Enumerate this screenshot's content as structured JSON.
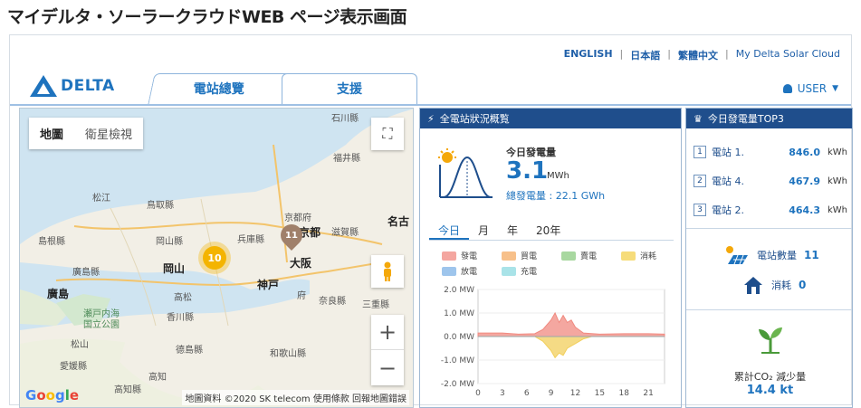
{
  "page_title": "マイデルタ・ソーラークラウドWEB ページ表示画面",
  "languages": [
    "ENGLISH",
    "日本語",
    "繁體中文",
    "My Delta Solar Cloud"
  ],
  "brand": {
    "logo_text": "DELTA",
    "color": "#1e73be"
  },
  "tabs": [
    {
      "label": "電站總覽"
    },
    {
      "label": "支援"
    }
  ],
  "user_menu": {
    "label": "USER"
  },
  "map": {
    "switch": {
      "map_label": "地圖",
      "satellite_label": "衛星檢視"
    },
    "clusters": [
      {
        "count": "10"
      }
    ],
    "pins": [
      {
        "count": "11"
      }
    ],
    "places": {
      "ishikawa": "石川縣",
      "fukui": "福井縣",
      "matsue": "松江",
      "tottori": "鳥取縣",
      "kyoto_fu": "京都府",
      "kyoto": "京都",
      "shiga": "滋賀縣",
      "nagoya": "名古",
      "shimane": "島根縣",
      "okayama_pref": "岡山縣",
      "hyogo": "兵庫縣",
      "hiroshima_pref": "廣島縣",
      "okayama": "岡山",
      "kobe": "神戸",
      "osaka": "大阪",
      "osaka_fu": "府",
      "hiroshima": "廣島",
      "takamatsu": "高松",
      "nara": "奈良縣",
      "mie": "三重縣",
      "setonaikai": "瀬戸内海",
      "kokuritsu": "国立公園",
      "kagawa": "香川縣",
      "matsuyama": "松山",
      "tokushima": "德島縣",
      "wakayama": "和歌山縣",
      "ehime": "愛媛縣",
      "kochi": "高知",
      "kochi_pref": "高知縣"
    },
    "google_letters": [
      "G",
      "o",
      "o",
      "g",
      "l",
      "e"
    ],
    "attribution": "地圖資料 ©2020 SK telecom   使用條款   回報地圖錯誤"
  },
  "overview": {
    "header": "全電站狀況概覧",
    "today_label": "今日發電量",
    "today_value": "3.1",
    "today_unit": "MWh",
    "total_label": "總發電量 : 22.1 GWh",
    "range_tabs": [
      "今日",
      "月",
      "年",
      "20年"
    ],
    "legend": [
      {
        "label": "發電",
        "color": "#f4a6a0"
      },
      {
        "label": "買電",
        "color": "#f7c08a"
      },
      {
        "label": "賣電",
        "color": "#a8d8a0"
      },
      {
        "label": "消耗",
        "color": "#f6dc7a"
      },
      {
        "label": "放電",
        "color": "#9ec5ec"
      },
      {
        "label": "充電",
        "color": "#a9e3e8"
      }
    ]
  },
  "chart_data": {
    "type": "area",
    "x": [
      0,
      3,
      6,
      9,
      12,
      15,
      18,
      21
    ],
    "x_tick_labels": [
      "0",
      "3",
      "6",
      "9",
      "12",
      "15",
      "18",
      "21"
    ],
    "y_tick_labels": [
      "2.0 MW",
      "1.0 MW",
      "0.0 MW",
      "-1.0 MW",
      "-2.0 MW"
    ],
    "ylim": [
      -2.0,
      2.0
    ],
    "series": [
      {
        "name": "發電",
        "color": "#f08a80",
        "points": [
          [
            0,
            0.15
          ],
          [
            3,
            0.15
          ],
          [
            5,
            0.1
          ],
          [
            7,
            0.12
          ],
          [
            8,
            0.3
          ],
          [
            9,
            0.7
          ],
          [
            9.5,
            1.0
          ],
          [
            10,
            0.6
          ],
          [
            10.5,
            0.9
          ],
          [
            11,
            0.6
          ],
          [
            11.5,
            0.7
          ],
          [
            12,
            0.4
          ],
          [
            13,
            0.15
          ],
          [
            15,
            0.1
          ],
          [
            18,
            0.12
          ],
          [
            21,
            0.12
          ],
          [
            23,
            0.1
          ]
        ]
      },
      {
        "name": "消耗",
        "color": "#f2cf5c",
        "points": [
          [
            0,
            0
          ],
          [
            7,
            0
          ],
          [
            8,
            -0.2
          ],
          [
            9,
            -0.6
          ],
          [
            9.5,
            -0.9
          ],
          [
            10,
            -0.7
          ],
          [
            10.5,
            -0.8
          ],
          [
            11,
            -0.5
          ],
          [
            12,
            -0.3
          ],
          [
            13,
            -0.1
          ],
          [
            14,
            0
          ],
          [
            23,
            0
          ]
        ]
      }
    ]
  },
  "top3": {
    "header": "今日發電量TOP3",
    "rows": [
      {
        "rank": "1",
        "name": "電站 1.",
        "value": "846.0",
        "unit": "kWh"
      },
      {
        "rank": "2",
        "name": "電站 4.",
        "value": "467.9",
        "unit": "kWh"
      },
      {
        "rank": "3",
        "name": "電站 2.",
        "value": "464.3",
        "unit": "kWh"
      }
    ]
  },
  "stats": {
    "plant_count_label": "電站數量",
    "plant_count": "11",
    "consumption_label": "消耗",
    "consumption_value": "0",
    "co2_label": "累計CO₂ 減少量",
    "co2_value": "14.4 kt"
  }
}
